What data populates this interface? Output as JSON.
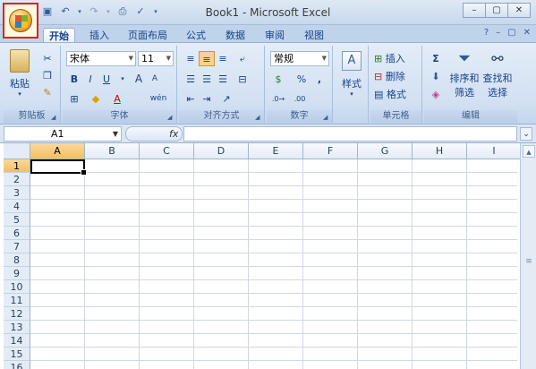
{
  "window": {
    "title": "Book1 - Microsoft Excel",
    "controls": [
      "–",
      "▢",
      "✕"
    ]
  },
  "quick_access": [
    "save-icon",
    "undo-icon",
    "redo-icon",
    "print-preview-icon",
    "spelling-icon",
    "customize-icon"
  ],
  "tabs": [
    {
      "label": "开始",
      "active": true
    },
    {
      "label": "插入"
    },
    {
      "label": "页面布局"
    },
    {
      "label": "公式"
    },
    {
      "label": "数据"
    },
    {
      "label": "审阅"
    },
    {
      "label": "视图"
    }
  ],
  "ribbon": {
    "clipboard": {
      "paste_label": "粘贴",
      "group_label": "剪贴板"
    },
    "font": {
      "font_name": "宋体",
      "font_size": "11",
      "bold": "B",
      "italic": "I",
      "underline": "U",
      "grow": "A",
      "shrink": "A",
      "font_color": "A",
      "wen": "wén",
      "group_label": "字体"
    },
    "alignment": {
      "group_label": "对齐方式"
    },
    "number": {
      "format": "常规",
      "percent": "%",
      "comma": ",",
      "group_label": "数字"
    },
    "styles": {
      "label": "样式"
    },
    "cells": {
      "insert": "插入",
      "delete": "删除",
      "format": "格式",
      "group_label": "单元格"
    },
    "editing": {
      "sigma": "Σ",
      "sort_line1": "排序和",
      "sort_line2": "筛选",
      "find_line1": "查找和",
      "find_line2": "选择",
      "group_label": "编辑"
    }
  },
  "formula_bar": {
    "name_box": "A1",
    "fx": "fx",
    "formula": ""
  },
  "sheet": {
    "columns": [
      "A",
      "B",
      "C",
      "D",
      "E",
      "F",
      "G",
      "H",
      "I"
    ],
    "rows": [
      "1",
      "2",
      "3",
      "4",
      "5",
      "6",
      "7",
      "8",
      "9",
      "10",
      "11",
      "12",
      "13",
      "14",
      "15",
      "16"
    ],
    "selected_cell": "A1"
  }
}
